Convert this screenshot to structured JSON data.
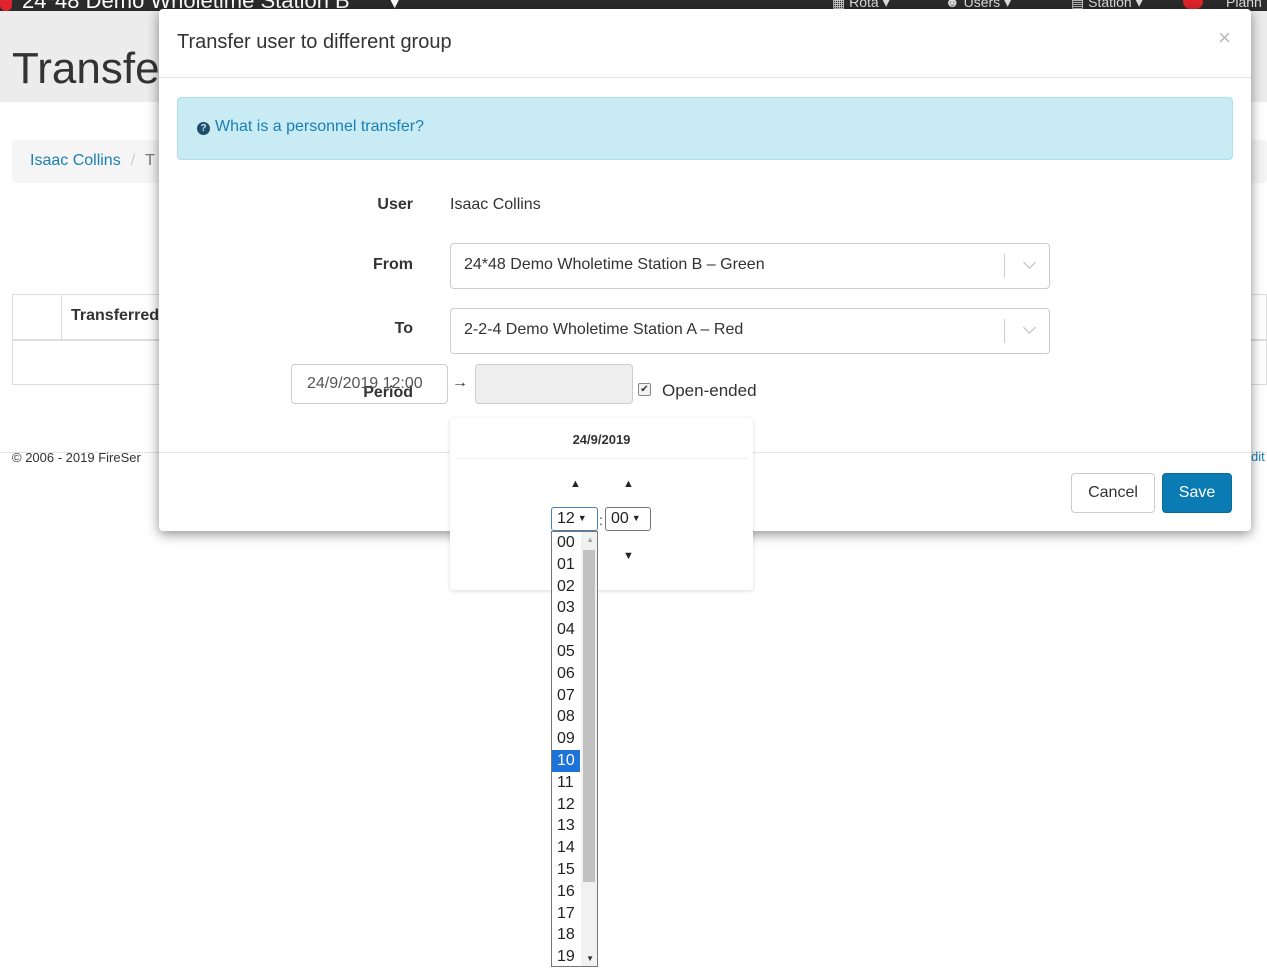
{
  "navbar": {
    "brand": "24*48 Demo Wholetime Station B",
    "items": [
      "Rota",
      "Users",
      "Station",
      "Plann"
    ],
    "accent": "#e0242b"
  },
  "page": {
    "title": "Transfe",
    "breadcrumb_link": "Isaac Collins",
    "breadcrumb_current": "T",
    "table_header": "Transferred",
    "footer_text": "© 2006 - 2019 FireSer",
    "footer_link": "dit"
  },
  "modal": {
    "title": "Transfer user to different group",
    "close": "×",
    "info_link": "What is a personnel transfer?",
    "info_icon": "question-circle-icon",
    "labels": {
      "user": "User",
      "from": "From",
      "to": "To",
      "period": "Period"
    },
    "user_value": "Isaac Collins",
    "from_value": "24*48 Demo Wholetime Station B – Green",
    "to_value": "2-2-4 Demo Wholetime Station A – Red",
    "period_start": "24/9/2019 12:00",
    "period_end": "",
    "arrow": "→",
    "open_ended_label": "Open-ended",
    "open_ended_checked": true,
    "cancel_label": "Cancel",
    "save_label": "Save",
    "save_color": "#0a7cb3"
  },
  "picker": {
    "date": "24/9/2019",
    "hour_selected": "12",
    "minute_selected": "00",
    "colon": ":",
    "hours": [
      "00",
      "01",
      "02",
      "03",
      "04",
      "05",
      "06",
      "07",
      "08",
      "09",
      "10",
      "11",
      "12",
      "13",
      "14",
      "15",
      "16",
      "17",
      "18",
      "19"
    ],
    "highlighted_hour": "10"
  }
}
